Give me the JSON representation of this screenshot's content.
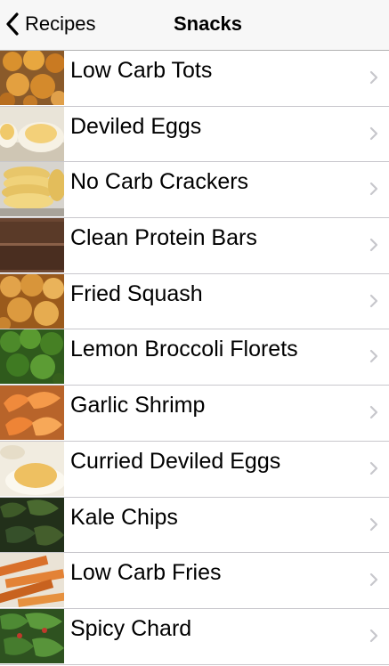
{
  "navbar": {
    "back_label": "Recipes",
    "title": "Snacks"
  },
  "items": [
    {
      "label": "Low Carb Tots",
      "icon": "tots-thumbnail"
    },
    {
      "label": "Deviled Eggs",
      "icon": "deviled-eggs-thumbnail"
    },
    {
      "label": "No Carb Crackers",
      "icon": "crackers-thumbnail"
    },
    {
      "label": "Clean Protein Bars",
      "icon": "protein-bars-thumbnail"
    },
    {
      "label": "Fried Squash",
      "icon": "fried-squash-thumbnail"
    },
    {
      "label": "Lemon Broccoli Florets",
      "icon": "broccoli-thumbnail"
    },
    {
      "label": "Garlic Shrimp",
      "icon": "shrimp-thumbnail"
    },
    {
      "label": "Curried Deviled Eggs",
      "icon": "curried-eggs-thumbnail"
    },
    {
      "label": "Kale Chips",
      "icon": "kale-chips-thumbnail"
    },
    {
      "label": "Low Carb Fries",
      "icon": "fries-thumbnail"
    },
    {
      "label": "Spicy Chard",
      "icon": "chard-thumbnail"
    }
  ],
  "colors": {
    "navbar_bg": "#f7f7f7",
    "separator": "#c8c7cc",
    "chevron": "#c7c7cc"
  }
}
